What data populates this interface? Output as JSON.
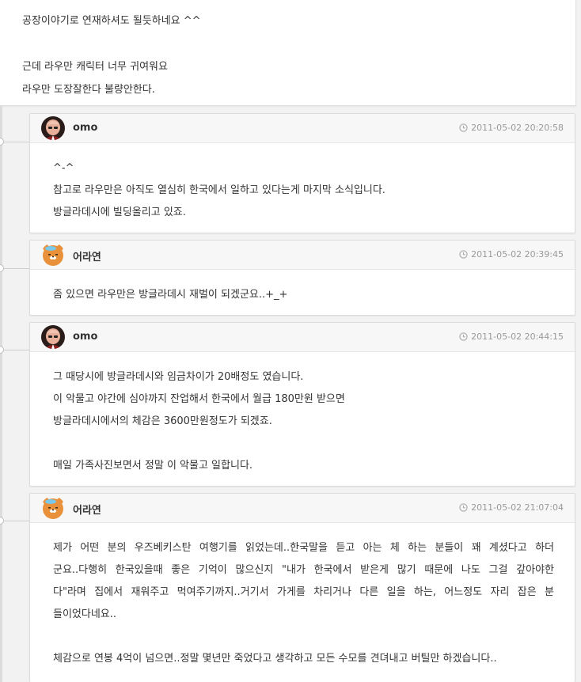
{
  "post": {
    "lines": [
      "공장이야기로 연재하셔도 될듯하네요 ^^",
      "",
      "근데 라우만 캐릭터 너무 귀여워요",
      "라우만 도장잘한다 불량안한다."
    ]
  },
  "comments": [
    {
      "author": "omo",
      "avatar_icon": "bald-man-avatar-icon",
      "date": "2011-05-02 20:20:58",
      "lines": [
        "^-^",
        "참고로 라우만은 아직도 열심히 한국에서 일하고 있다는게 마지막 소식입니다.",
        "방글라데시에 빌딩올리고 있죠."
      ]
    },
    {
      "author": "어라연",
      "avatar_icon": "ryan-bear-avatar-icon",
      "date": "2011-05-02 20:39:45",
      "lines": [
        "좀 있으면 라우만은 방글라데시 재벌이 되겠군요..+_+"
      ]
    },
    {
      "author": "omo",
      "avatar_icon": "bald-man-avatar-icon",
      "date": "2011-05-02 20:44:15",
      "lines": [
        "그 때당시에 방글라데시와 임금차이가 20배정도 였습니다.",
        "이 악물고 야간에 심야까지 잔업해서 한국에서 월급 180만원 받으면",
        "방글라데시에서의 체감은 3600만원정도가 되겠죠.",
        "",
        "매일 가족사진보면서 정말 이 악물고 일합니다."
      ]
    },
    {
      "author": "어라연",
      "avatar_icon": "ryan-bear-avatar-icon",
      "date": "2011-05-02 21:07:04",
      "lines": [
        "제가 어떤 분의 우즈베키스탄 여행기를 읽었는데..한국말을 듣고 아는 체 하는 분들이 꽤 계셨다고 하더",
        "군요..다행히 한국있을때 좋은 기억이 많으신지 \"내가 한국에서 받은게 많기 때문에 나도 그걸 갚아야한",
        "다\"라며 집에서 재워주고 먹여주기까지..거기서 가게를 차리거나 다른 일을 하는, 어느정도 자리 잡은 분",
        "들이었다네요..",
        "",
        "체감으로 연봉 4억이 넘으면..정말 몇년만 죽었다고 생각하고 모든 수모를 견뎌내고 버틸만 하겠습니다.."
      ]
    }
  ]
}
